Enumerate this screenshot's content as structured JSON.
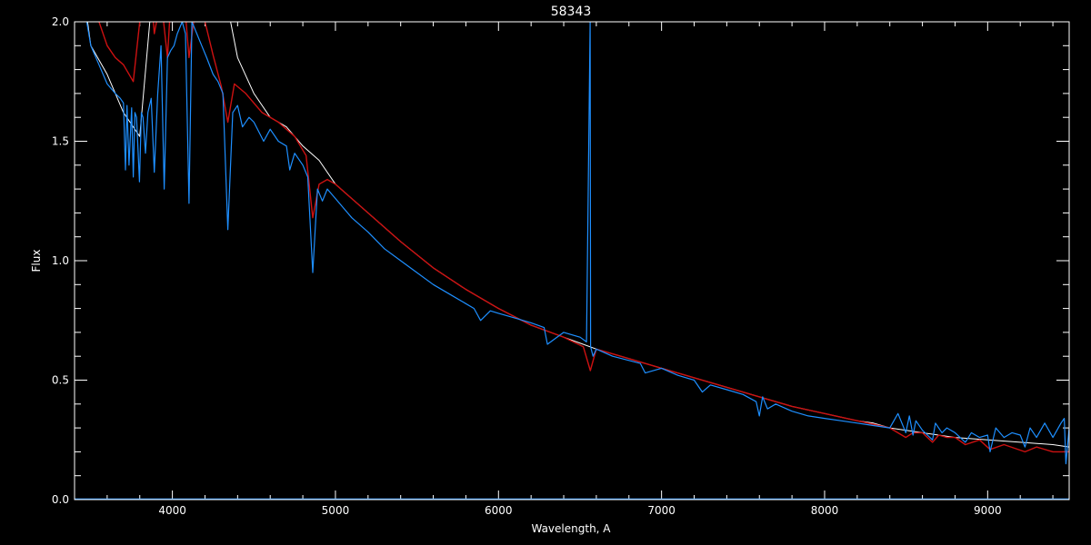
{
  "chart_data": {
    "type": "line",
    "title": "58343",
    "xlabel": "Wavelength, A",
    "ylabel": "Flux",
    "xlim": [
      3400,
      9500
    ],
    "ylim": [
      0.0,
      2.0
    ],
    "x_ticks": [
      4000,
      5000,
      6000,
      7000,
      8000,
      9000
    ],
    "x_tick_labels": [
      "4000",
      "5000",
      "6000",
      "7000",
      "8000",
      "9000"
    ],
    "y_ticks": [
      0.0,
      0.5,
      1.0,
      1.5,
      2.0
    ],
    "y_tick_labels": [
      "0.0",
      "0.5",
      "1.0",
      "1.5",
      "2.0"
    ],
    "x_minor_step": 200,
    "y_minor_step": 0.1,
    "grid": false,
    "background": "#000000",
    "series": [
      {
        "color": "#ffffff",
        "x": [
          3400,
          3500,
          3600,
          3700,
          3800,
          3900,
          4000,
          4100,
          4200,
          4300,
          4400,
          4500,
          4600,
          4700,
          4800,
          4900,
          5000,
          5200,
          5400,
          5600,
          5800,
          6000,
          6200,
          6400,
          6600,
          6800,
          7000,
          7200,
          7400,
          7600,
          7800,
          8000,
          8200,
          8300,
          8400,
          8600,
          8800,
          9000,
          9200,
          9400,
          9500
        ],
        "y": [
          2.4,
          1.9,
          1.78,
          1.62,
          1.52,
          2.3,
          2.5,
          2.7,
          2.4,
          2.2,
          1.85,
          1.7,
          1.6,
          1.56,
          1.48,
          1.42,
          1.32,
          1.2,
          1.08,
          0.97,
          0.88,
          0.8,
          0.73,
          0.68,
          0.63,
          0.59,
          0.55,
          0.51,
          0.47,
          0.43,
          0.39,
          0.36,
          0.33,
          0.32,
          0.3,
          0.28,
          0.26,
          0.25,
          0.24,
          0.23,
          0.22
        ]
      },
      {
        "color": "#cc1111",
        "x": [
          3400,
          3500,
          3600,
          3650,
          3700,
          3760,
          3800,
          3850,
          3889,
          3930,
          3970,
          4000,
          4060,
          4102,
          4140,
          4200,
          4250,
          4300,
          4340,
          4380,
          4450,
          4550,
          4650,
          4750,
          4820,
          4861,
          4900,
          4950,
          5000,
          5200,
          5400,
          5600,
          5800,
          6000,
          6200,
          6400,
          6520,
          6563,
          6600,
          6700,
          6800,
          7000,
          7200,
          7400,
          7600,
          7800,
          8000,
          8200,
          8400,
          8498,
          8542,
          8600,
          8662,
          8700,
          8750,
          8800,
          8863,
          8950,
          9015,
          9100,
          9229,
          9300,
          9400,
          9500
        ],
        "y": [
          2.5,
          2.1,
          1.9,
          1.85,
          1.82,
          1.75,
          2.0,
          2.3,
          1.95,
          2.1,
          1.85,
          2.2,
          2.2,
          1.85,
          2.05,
          2.0,
          1.86,
          1.73,
          1.58,
          1.74,
          1.7,
          1.62,
          1.58,
          1.52,
          1.44,
          1.18,
          1.32,
          1.34,
          1.32,
          1.2,
          1.08,
          0.97,
          0.88,
          0.8,
          0.73,
          0.68,
          0.64,
          0.54,
          0.63,
          0.61,
          0.59,
          0.55,
          0.51,
          0.47,
          0.43,
          0.39,
          0.36,
          0.33,
          0.3,
          0.26,
          0.28,
          0.28,
          0.24,
          0.27,
          0.26,
          0.26,
          0.23,
          0.25,
          0.21,
          0.23,
          0.2,
          0.22,
          0.2,
          0.2
        ]
      },
      {
        "color": "#1e8fff",
        "x": [
          3400,
          3500,
          3550,
          3600,
          3650,
          3680,
          3700,
          3712,
          3722,
          3734,
          3750,
          3760,
          3770,
          3780,
          3798,
          3810,
          3820,
          3835,
          3850,
          3870,
          3889,
          3910,
          3930,
          3950,
          3970,
          3990,
          4010,
          4030,
          4060,
          4080,
          4102,
          4120,
          4150,
          4180,
          4210,
          4250,
          4280,
          4310,
          4340,
          4370,
          4400,
          4430,
          4470,
          4500,
          4560,
          4600,
          4650,
          4700,
          4720,
          4750,
          4800,
          4830,
          4861,
          4890,
          4920,
          4950,
          5000,
          5050,
          5100,
          5200,
          5300,
          5400,
          5500,
          5600,
          5700,
          5800,
          5850,
          5890,
          5950,
          6000,
          6100,
          6200,
          6280,
          6300,
          6400,
          6500,
          6540,
          6562,
          6565,
          6580,
          6600,
          6700,
          6870,
          6900,
          7000,
          7100,
          7200,
          7250,
          7300,
          7400,
          7500,
          7580,
          7600,
          7620,
          7650,
          7700,
          7800,
          7900,
          8000,
          8100,
          8200,
          8300,
          8400,
          8450,
          8498,
          8520,
          8542,
          8560,
          8600,
          8662,
          8680,
          8720,
          8750,
          8800,
          8863,
          8900,
          8950,
          9000,
          9015,
          9050,
          9100,
          9150,
          9200,
          9229,
          9260,
          9300,
          9350,
          9400,
          9450,
          9470,
          9480,
          9500
        ],
        "y": [
          2.3,
          1.9,
          1.82,
          1.74,
          1.7,
          1.68,
          1.66,
          1.38,
          1.65,
          1.4,
          1.64,
          1.35,
          1.62,
          1.6,
          1.33,
          1.62,
          1.6,
          1.45,
          1.62,
          1.68,
          1.37,
          1.7,
          1.9,
          1.3,
          1.85,
          1.88,
          1.9,
          1.95,
          2.0,
          1.95,
          1.24,
          2.0,
          1.95,
          1.9,
          1.85,
          1.78,
          1.75,
          1.7,
          1.13,
          1.62,
          1.65,
          1.56,
          1.6,
          1.58,
          1.5,
          1.55,
          1.5,
          1.48,
          1.38,
          1.45,
          1.4,
          1.35,
          0.95,
          1.3,
          1.25,
          1.3,
          1.26,
          1.22,
          1.18,
          1.12,
          1.05,
          1.0,
          0.95,
          0.9,
          0.86,
          0.82,
          0.8,
          0.75,
          0.79,
          0.78,
          0.76,
          0.74,
          0.72,
          0.65,
          0.7,
          0.68,
          0.66,
          2.0,
          0.64,
          0.6,
          0.63,
          0.6,
          0.57,
          0.53,
          0.55,
          0.52,
          0.5,
          0.45,
          0.48,
          0.46,
          0.44,
          0.41,
          0.35,
          0.43,
          0.38,
          0.4,
          0.37,
          0.35,
          0.34,
          0.33,
          0.32,
          0.31,
          0.3,
          0.36,
          0.28,
          0.35,
          0.27,
          0.33,
          0.29,
          0.25,
          0.32,
          0.28,
          0.3,
          0.28,
          0.24,
          0.28,
          0.26,
          0.27,
          0.2,
          0.3,
          0.26,
          0.28,
          0.27,
          0.22,
          0.3,
          0.26,
          0.32,
          0.26,
          0.32,
          0.34,
          0.15,
          0.3
        ]
      }
    ]
  }
}
